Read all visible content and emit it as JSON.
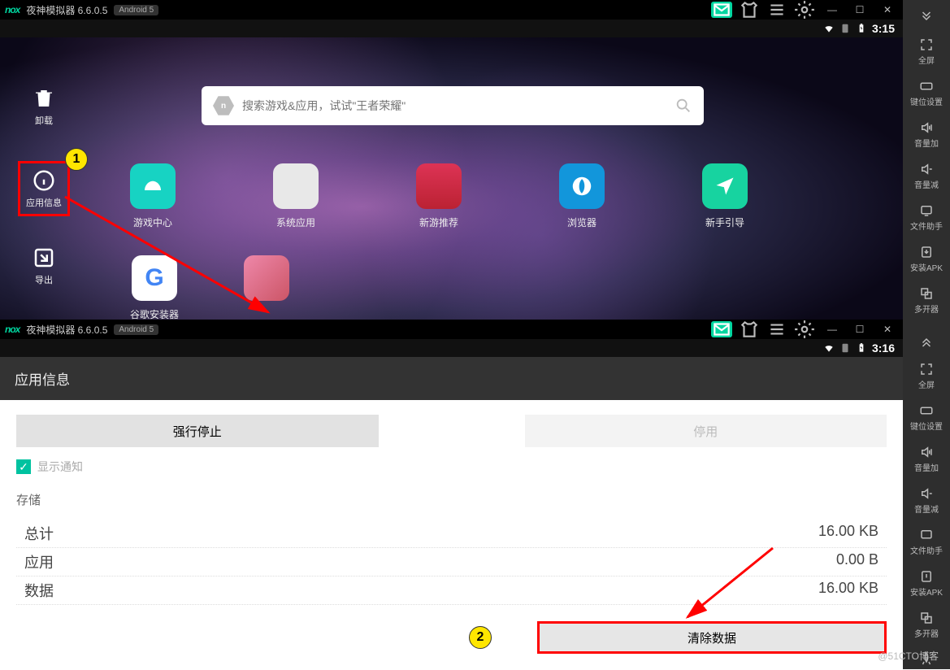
{
  "titlebar": {
    "app": "nox",
    "name": "夜神模拟器 6.6.0.5",
    "platform": "Android 5"
  },
  "status": {
    "time1": "3:15",
    "time2": "3:16"
  },
  "sidetools": {
    "uninstall": "卸载",
    "appinfo": "应用信息",
    "export": "导出"
  },
  "search": {
    "placeholder": "搜索游戏&应用，试试\"王者荣耀\""
  },
  "apps": {
    "row1": [
      "游戏中心",
      "系统应用",
      "新游推荐",
      "浏览器",
      "新手引导"
    ],
    "row2": [
      "谷歌安装器",
      ""
    ]
  },
  "appinfo": {
    "title": "应用信息",
    "force_stop": "强行停止",
    "disable": "停用",
    "show_notif": "显示通知",
    "storage_header": "存储",
    "total_k": "总计",
    "total_v": "16.00 KB",
    "app_k": "应用",
    "app_v": "0.00 B",
    "data_k": "数据",
    "data_v": "16.00 KB",
    "clear": "清除数据"
  },
  "rtools": {
    "fullscreen": "全屏",
    "keymap": "键位设置",
    "volup": "音量加",
    "voldown": "音量减",
    "filehelper": "文件助手",
    "installapk": "安装APK",
    "multi": "多开器"
  },
  "badges": {
    "b1": "1",
    "b2": "2"
  },
  "watermark": "@51CTO博客"
}
